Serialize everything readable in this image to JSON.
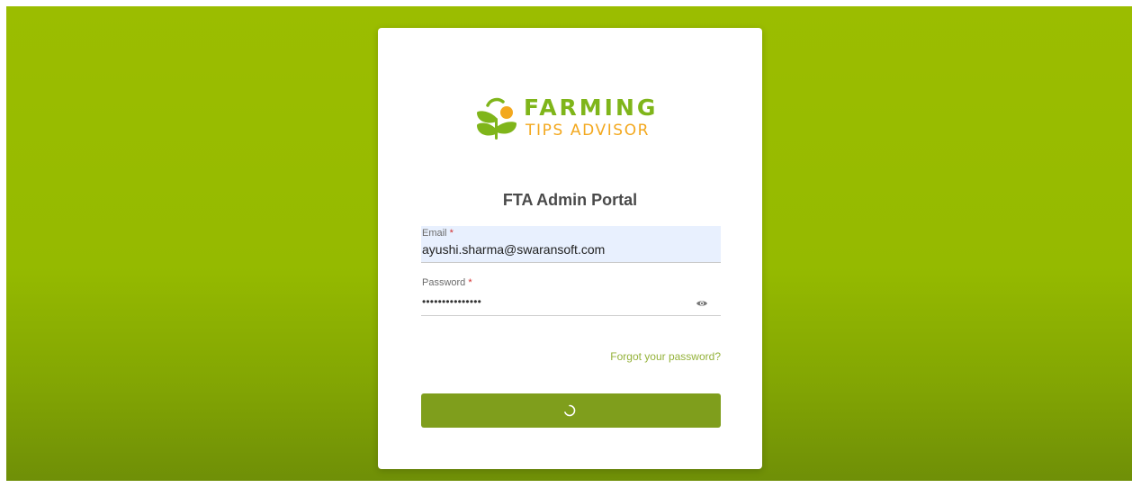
{
  "logo": {
    "line1": "FARMING",
    "line2": "TIPS ADVISOR"
  },
  "portal_title": "FTA Admin Portal",
  "email": {
    "label": "Email",
    "required_mark": "*",
    "value": "ayushi.sharma@swaransoft.com"
  },
  "password": {
    "label": "Password",
    "required_mark": "*",
    "value": "•••••••••••••••",
    "toggle_icon": "eye-icon"
  },
  "forgot_link": "Forgot your password?",
  "submit": {
    "state": "loading",
    "icon": "spinner-icon"
  },
  "colors": {
    "background": "#95ba00",
    "brand_green": "#7fb51a",
    "brand_orange": "#f3a81e",
    "button": "#7f9e1c",
    "link": "#94b23a",
    "autofill": "#e8f0fe"
  }
}
